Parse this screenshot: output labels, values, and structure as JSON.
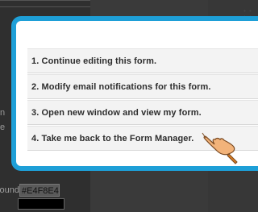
{
  "background": {
    "left_fragment_1": "n",
    "left_fragment_2": "e",
    "background_label": "ound",
    "background_value": "#E4F8E4"
  },
  "modal": {
    "options": [
      {
        "label": "1. Continue editing this form."
      },
      {
        "label": "2. Modify email notifications for this form."
      },
      {
        "label": "3. Open new window and view my form."
      },
      {
        "label": "4. Take me back to the Form Manager."
      }
    ],
    "accent_color": "#1e9fd7"
  },
  "pointer": {
    "icon": "pointing-hand-icon"
  }
}
